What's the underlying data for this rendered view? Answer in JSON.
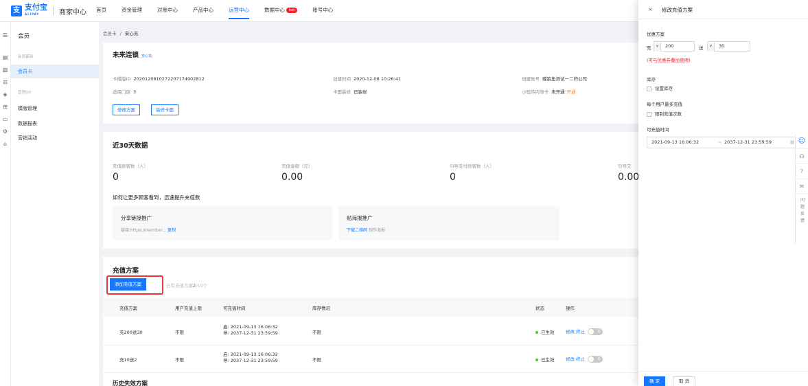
{
  "topbar": {
    "logo_mark": "支",
    "logo_name": "支付宝",
    "logo_sub": "ALIPAY",
    "logo_center": "商家中心",
    "nav": [
      "首页",
      "资金管理",
      "对账中心",
      "产品中心",
      "运营中心",
      "数据中心",
      "账号中心"
    ],
    "nav_active": "运营中心",
    "hot_badge": "hot"
  },
  "menu": {
    "title": "会员",
    "group1": "会员基础",
    "member_card": "会员卡",
    "group2": "营销GO",
    "items": [
      "模版管理",
      "数据报表",
      "营销活动"
    ]
  },
  "breadcrumb": {
    "parent": "会员卡",
    "sep": "/",
    "current": "安心充"
  },
  "card_info": {
    "title": "未来连锁",
    "tag": "安心充",
    "template_id_label": "卡模版ID",
    "template_id": "20201208102722071749028​12",
    "stores_label": "适用门店",
    "stores": "3",
    "created_label": "创建时间",
    "created": "2020-12-08 10:26:41",
    "decor_label": "卡面装修",
    "decor": "已装修",
    "account_label": "创建账号",
    "account": "蝶狼鱼测试一二的公司",
    "miniapp_label": "小程序内领卡",
    "miniapp": "未开通",
    "miniapp_link": "开通",
    "btn_edit_plan": "修改方案",
    "btn_decor": "装修卡面"
  },
  "stats": {
    "title": "近30天数据",
    "items": [
      {
        "label": "充值顾客数（人）",
        "value": "0"
      },
      {
        "label": "充值金额（元）",
        "value": "0.00"
      },
      {
        "label": "引导支付顾客数（人）",
        "value": "0"
      },
      {
        "label": "引导交",
        "value": "0.00"
      }
    ],
    "promo_title": "如何让更多顾客看到，迅速提升充值数",
    "promo1_title": "分享链接推广",
    "promo1_desc": "链接:https://member...",
    "promo1_link": "复制",
    "promo2_title": "贴海报推广",
    "promo2_link": "下载二维码",
    "promo2_desc": "制作海报"
  },
  "plans": {
    "title": "充值方案",
    "add_button": "添加充值方案",
    "hint_prefix": "已有充值方案",
    "hint_count": "2",
    "hint_suffix": "/10个",
    "headers": [
      "充值方案",
      "用户充值上限",
      "可充值时间",
      "库存情况",
      "状态",
      "操作"
    ],
    "rows": [
      {
        "name": "充200送30",
        "limit": "不限",
        "start": "启: 2021-09-13 16:06:32",
        "end": "停: 2037-12-31 23:59:59",
        "stock": "不限",
        "status": "已生效",
        "edit": "修改",
        "stop": "终止"
      },
      {
        "name": "充10送2",
        "limit": "不限",
        "start": "启: 2021-09-13 16:06:32",
        "end": "停: 2037-12-31 23:59:59",
        "stock": "不限",
        "status": "已生效",
        "edit": "修改",
        "stop": "终止"
      }
    ],
    "history_title": "历史失效方案"
  },
  "drawer": {
    "close": "×",
    "title": "修改充值方案",
    "offer_label": "优惠方案",
    "charge_word": "充",
    "charge_value": "200",
    "bonus_word": "送",
    "bonus_value": "30",
    "currency": "¥",
    "warning": "(可与优惠券叠加使用)",
    "stock_label": "库存",
    "stock_check": "设置库存",
    "limit_label": "每个用户最多充值",
    "limit_check": "限制充值次数",
    "time_label": "可充值时间",
    "time_start": "2021-09-13 16:06:32",
    "time_sep": "→",
    "time_end": "2037-12-31 23:59:59",
    "ok": "确 定",
    "cancel": "取 消"
  },
  "float_bar": {
    "feedback": "问题反馈"
  }
}
